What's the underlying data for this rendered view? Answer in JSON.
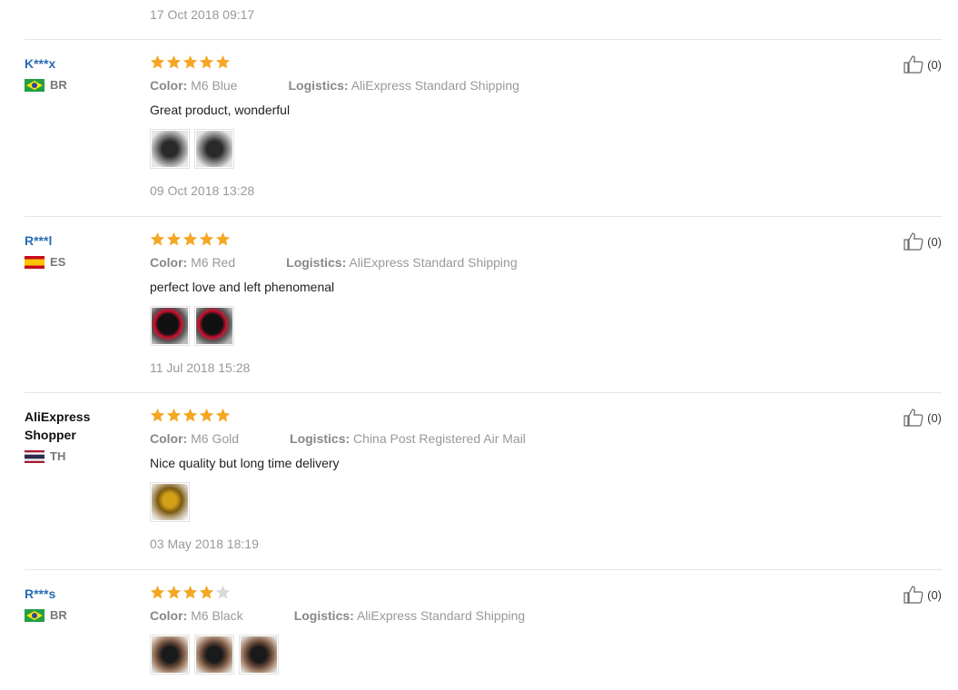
{
  "top_date": "17 Oct 2018 09:17",
  "labels": {
    "color": "Color:",
    "logistics": "Logistics:"
  },
  "reviews": [
    {
      "user": "K***x",
      "country": "BR",
      "flag": "brazil",
      "rating": 5,
      "color": "M6 Blue",
      "logistics": "AliExpress Standard Shipping",
      "text": "Great product, wonderful",
      "photos": [
        "photo-dark-ring",
        "photo-dark-ring"
      ],
      "date": "09 Oct 2018 13:28",
      "helpful": "(0)"
    },
    {
      "user": "R***l",
      "country": "ES",
      "flag": "spain",
      "rating": 5,
      "color": "M6 Red",
      "logistics": "AliExpress Standard Shipping",
      "text": "perfect love and left phenomenal",
      "photos": [
        "photo-red-ring",
        "photo-red-ring"
      ],
      "date": "11 Jul 2018 15:28",
      "helpful": "(0)"
    },
    {
      "user": "AliExpress Shopper",
      "country": "TH",
      "flag": "thailand",
      "rating": 5,
      "color": "M6 Gold",
      "logistics": "China Post Registered Air Mail",
      "text": "Nice quality but long time delivery",
      "photos": [
        "photo-gold-ring"
      ],
      "date": "03 May 2018 18:19",
      "helpful": "(0)"
    },
    {
      "user": "R***s",
      "country": "BR",
      "flag": "brazil",
      "rating": 4,
      "color": "M6 Black",
      "logistics": "AliExpress Standard Shipping",
      "text": "",
      "photos": [
        "photo-black-ring",
        "photo-black-ring",
        "photo-black-ring"
      ],
      "date": "",
      "helpful": "(0)"
    }
  ],
  "colors": {
    "star": "#f5a623",
    "star_empty": "#d9d9d9",
    "link": "#2a6bb6",
    "muted": "#999999"
  }
}
